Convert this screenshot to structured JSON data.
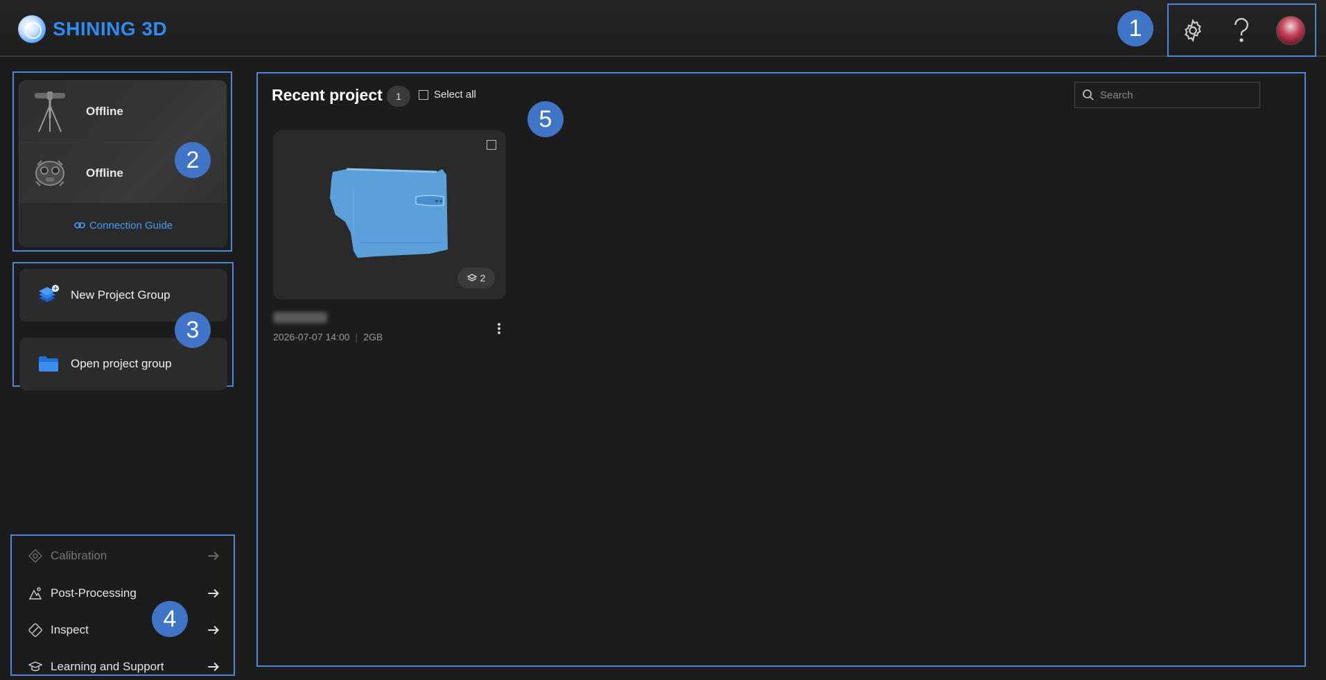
{
  "header": {
    "logo_text": "SHINING 3D",
    "icons": [
      "gear-icon",
      "help-icon",
      "user-avatar"
    ]
  },
  "callouts": [
    "1",
    "2",
    "3",
    "4",
    "5"
  ],
  "devices": {
    "items": [
      {
        "icon": "tripod-scanner-icon",
        "status": "Offline"
      },
      {
        "icon": "handheld-scanner-icon",
        "status": "Offline"
      }
    ],
    "guide_label": "Connection Guide"
  },
  "project_actions": {
    "new_label": "New Project Group",
    "open_label": "Open project group"
  },
  "tools": [
    {
      "label": "Calibration",
      "enabled": false,
      "icon": "calibration-icon"
    },
    {
      "label": "Post-Processing",
      "enabled": true,
      "icon": "post-processing-icon"
    },
    {
      "label": "Inspect",
      "enabled": true,
      "icon": "inspect-icon"
    },
    {
      "label": "Learning and Support",
      "enabled": true,
      "icon": "graduation-cap-icon"
    }
  ],
  "main": {
    "title": "Recent project",
    "count": "1",
    "select_all_label": "Select all",
    "search_placeholder": "Search",
    "projects": [
      {
        "thumbnail": "car-door-scan",
        "layers": "2",
        "date": "2026-07-07 14:00",
        "size": "2GB"
      }
    ]
  },
  "colors": {
    "accent": "#2d8cf0",
    "callout": "#3f74c6",
    "outline": "#4f86d6",
    "background": "#1c1c1c",
    "card": "#2a2a2a",
    "scan_model": "#5b9fdb"
  }
}
